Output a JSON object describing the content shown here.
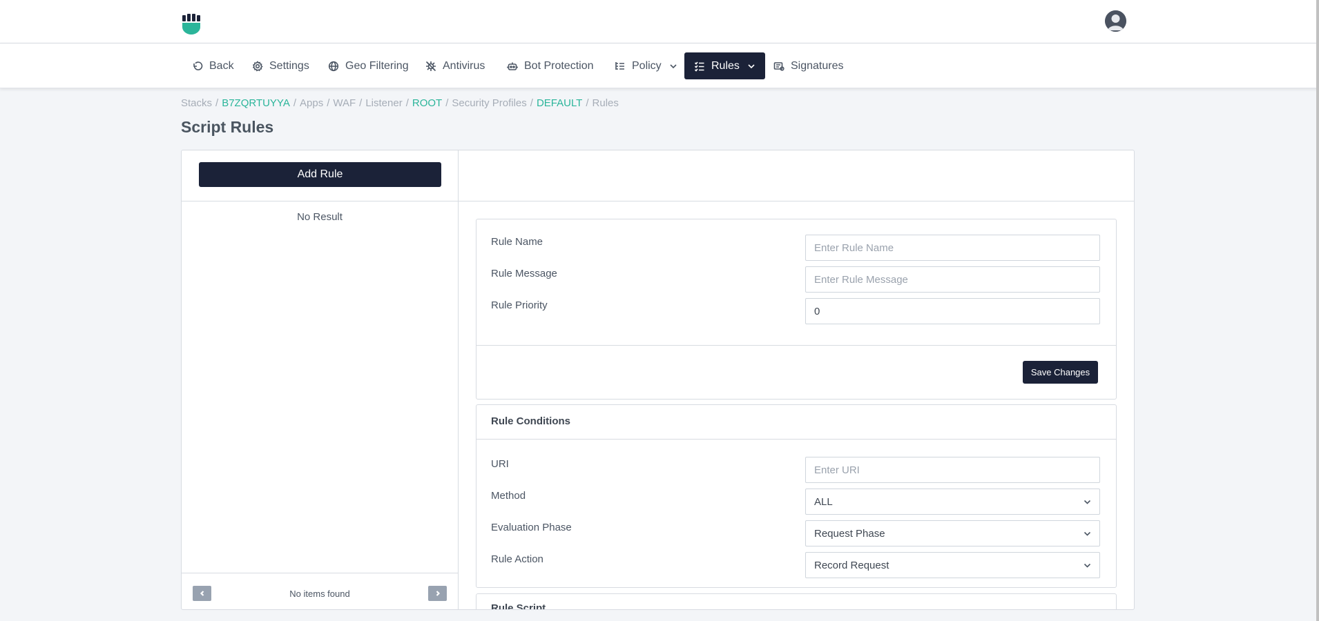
{
  "nav": {
    "items": [
      {
        "label": "Back",
        "icon": "undo-icon"
      },
      {
        "label": "Settings",
        "icon": "gear-icon"
      },
      {
        "label": "Geo Filtering",
        "icon": "globe-icon"
      },
      {
        "label": "Antivirus",
        "icon": "virus-slash-icon"
      },
      {
        "label": "Bot Protection",
        "icon": "robot-icon"
      },
      {
        "label": "Policy",
        "icon": "list-tree-icon"
      },
      {
        "label": "Rules",
        "icon": "list-check-icon"
      },
      {
        "label": "Signatures",
        "icon": "signature-icon"
      }
    ],
    "active": "Rules"
  },
  "breadcrumb": {
    "stacks": "Stacks",
    "stack_id": "B7ZQRTUYYA",
    "apps": "Apps",
    "waf": "WAF",
    "listener": "Listener",
    "root": "ROOT",
    "security_profiles": "Security Profiles",
    "profile": "DEFAULT",
    "rules": "Rules",
    "separator": "/"
  },
  "page": {
    "title": "Script Rules"
  },
  "rule_list": {
    "add_label": "Add Rule",
    "empty_text": "No Result",
    "pagination_text": "No items found"
  },
  "rule_form": {
    "name_label": "Rule Name",
    "name_placeholder": "Enter Rule Name",
    "message_label": "Rule Message",
    "message_placeholder": "Enter Rule Message",
    "priority_label": "Rule Priority",
    "priority_value": "0",
    "save_label": "Save Changes"
  },
  "conditions": {
    "title": "Rule Conditions",
    "uri_label": "URI",
    "uri_placeholder": "Enter URI",
    "method_label": "Method",
    "method_value": "ALL",
    "phase_label": "Evaluation Phase",
    "phase_value": "Request Phase",
    "action_label": "Rule Action",
    "action_value": "Record Request"
  },
  "script": {
    "title": "Rule Script"
  },
  "colors": {
    "accent": "#2bb59a",
    "primary": "#1b2238"
  }
}
